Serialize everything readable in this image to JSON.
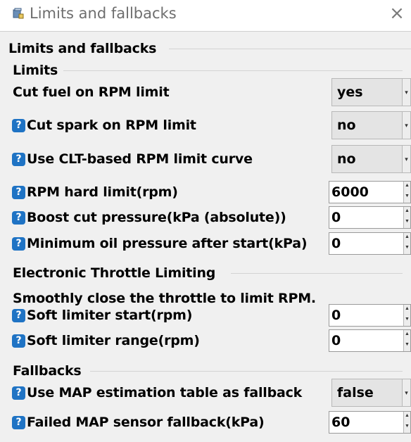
{
  "window": {
    "title": "Limits and fallbacks",
    "icon": "app-icon",
    "close_icon": "close-icon"
  },
  "panel": {
    "title": "Limits and fallbacks",
    "groups": [
      {
        "title": "Limits",
        "rows": [
          {
            "label": "Cut fuel on RPM limit",
            "help": false,
            "control": "dropdown",
            "value": "yes"
          },
          {
            "label": "Cut spark on RPM limit",
            "help": true,
            "control": "dropdown",
            "value": "no"
          },
          {
            "label": "Use CLT-based RPM limit curve",
            "help": true,
            "control": "dropdown",
            "value": "no"
          },
          {
            "label": "RPM hard limit(rpm)",
            "help": true,
            "control": "spinner",
            "value": "6000"
          },
          {
            "label": "Boost cut pressure(kPa (absolute))",
            "help": true,
            "control": "spinner",
            "value": "0"
          },
          {
            "label": "Minimum oil pressure after start(kPa)",
            "help": true,
            "control": "spinner",
            "value": "0"
          }
        ]
      },
      {
        "title": "Electronic Throttle Limiting",
        "description": "Smoothly close the throttle to limit RPM.",
        "rows": [
          {
            "label": "Soft limiter start(rpm)",
            "help": true,
            "control": "spinner",
            "value": "0"
          },
          {
            "label": "Soft limiter range(rpm)",
            "help": true,
            "control": "spinner",
            "value": "0"
          }
        ]
      },
      {
        "title": "Fallbacks",
        "rows": [
          {
            "label": "Use MAP estimation table as fallback",
            "help": true,
            "control": "dropdown",
            "value": "false"
          },
          {
            "label": "Failed MAP sensor fallback(kPa)",
            "help": true,
            "control": "spinner",
            "value": "60"
          }
        ]
      }
    ]
  },
  "icons": {
    "help": "help-icon",
    "help_glyph": "?",
    "dropdown_arrow": "▾",
    "spin_up": "▲",
    "spin_down": "▼"
  },
  "colors": {
    "help_icon": "#1f73c4",
    "panel_background": "#f0f0f0"
  }
}
